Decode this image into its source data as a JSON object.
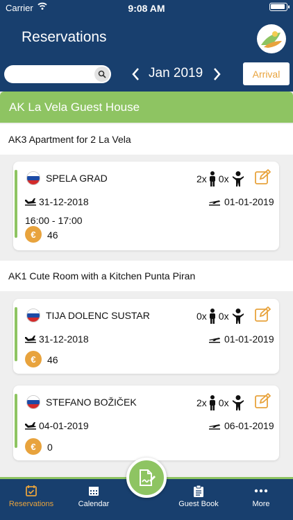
{
  "status": {
    "carrier": "Carrier",
    "time": "9:08 AM"
  },
  "header": {
    "title": "Reservations",
    "month": "Jan 2019",
    "arrival_label": "Arrival",
    "search_placeholder": ""
  },
  "property": {
    "name": "AK La Vela Guest House"
  },
  "units": [
    {
      "name": "AK3 Apartment for 2 La Vela"
    },
    {
      "name": "AK1 Cute Room with a Kitchen Punta Piran"
    }
  ],
  "reservations": [
    {
      "guest": "SPELA GRAD",
      "adults": "2x",
      "children": "0x",
      "checkin": "31-12-2018",
      "checkout": "01-01-2019",
      "time": "16:00 - 17:00",
      "amount": "46",
      "euro": "€"
    },
    {
      "guest": "TIJA DOLENC SUSTAR",
      "adults": "0x",
      "children": "0x",
      "checkin": "31-12-2018",
      "checkout": "01-01-2019",
      "amount": "46",
      "euro": "€"
    },
    {
      "guest": "STEFANO  BOŽIČEK",
      "adults": "2x",
      "children": "0x",
      "checkin": "04-01-2019",
      "checkout": "06-01-2019",
      "amount": "0",
      "euro": "€"
    }
  ],
  "tabs": [
    {
      "label": "Reservations",
      "icon": "calendar-check-icon"
    },
    {
      "label": "Calendar",
      "icon": "calendar-icon"
    },
    {
      "label": "Guest Book",
      "icon": "clipboard-icon"
    },
    {
      "label": "More",
      "icon": "more-icon"
    }
  ],
  "colors": {
    "navy": "#183f6e",
    "green": "#8ec462",
    "orange": "#e8a33d"
  }
}
